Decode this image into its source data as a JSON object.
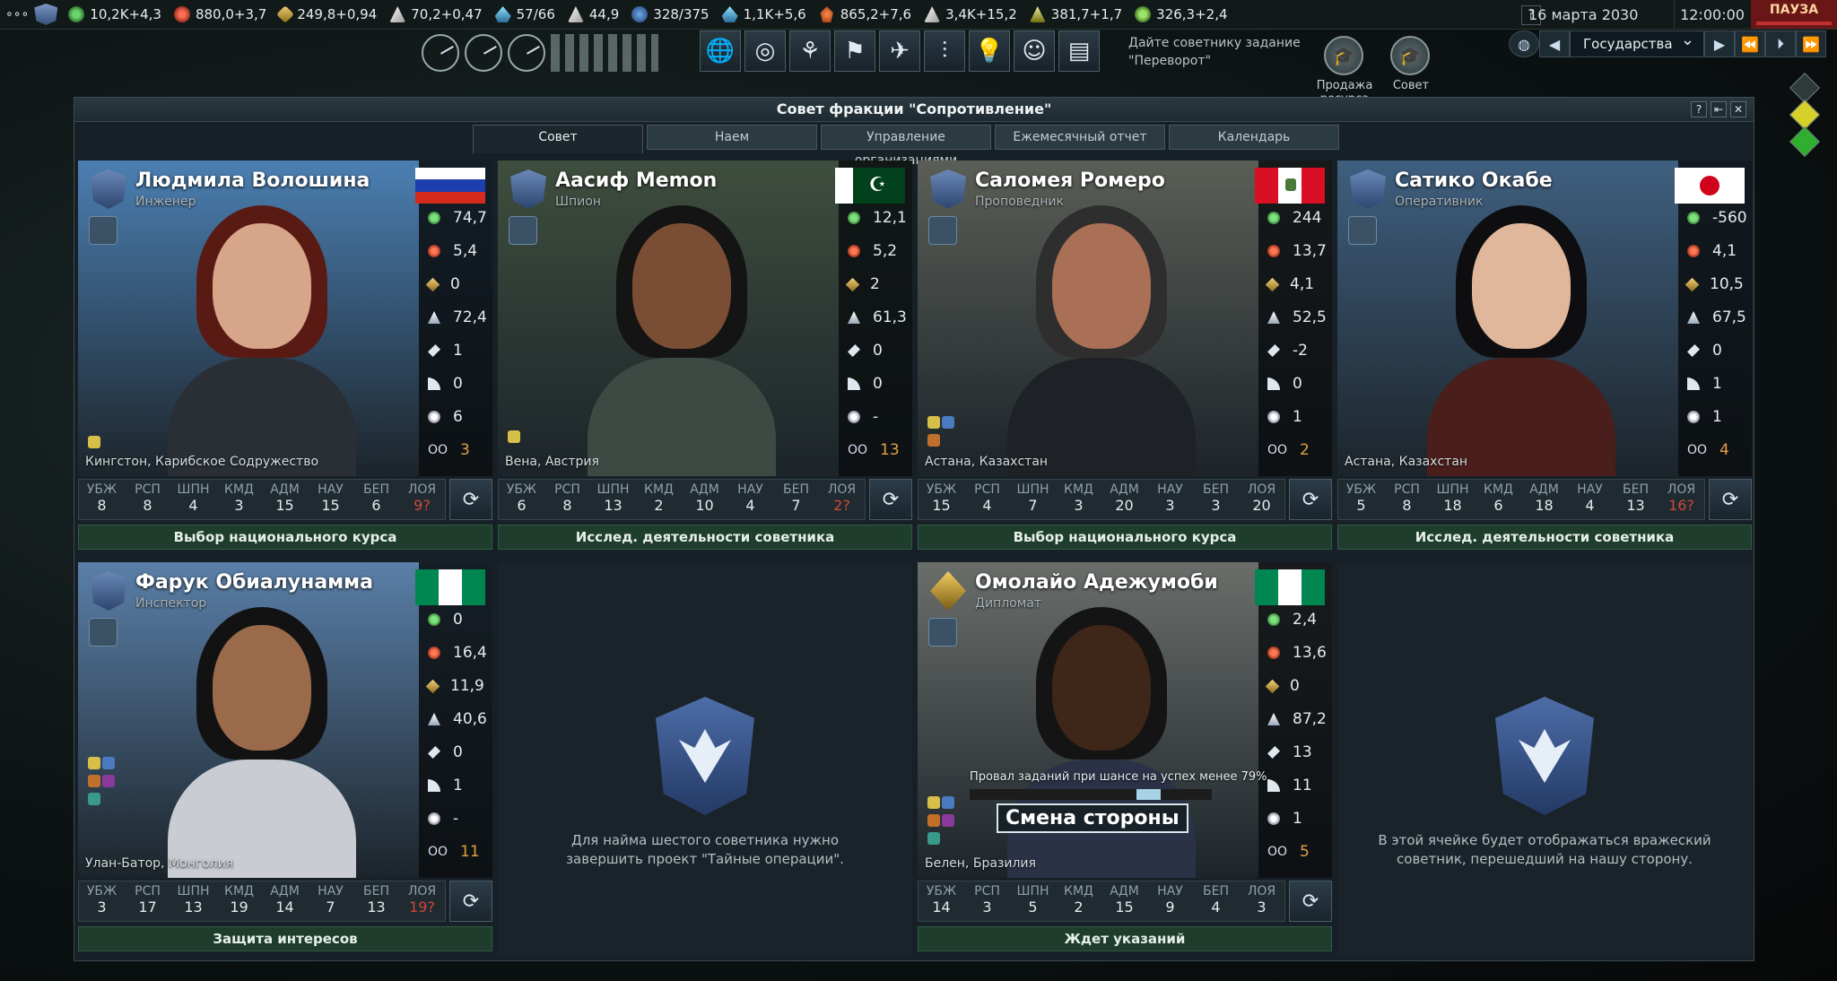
{
  "topbar": {
    "resources": [
      {
        "icon": "influence-icon",
        "color": "green",
        "value": "10,2K+4,3"
      },
      {
        "icon": "operations-icon",
        "color": "red",
        "value": "880,0+3,7"
      },
      {
        "icon": "boost-icon",
        "color": "gold",
        "value": "249,8+0,94"
      },
      {
        "icon": "mission-control-icon",
        "color": "white",
        "value": "70,2+0,47"
      },
      {
        "icon": "control-points-icon",
        "color": "cyan",
        "value": "57/66"
      },
      {
        "icon": "research-icon",
        "color": "white",
        "value": "44,9"
      },
      {
        "icon": "nations-icon",
        "color": "blue",
        "value": "328/375"
      },
      {
        "icon": "water-icon",
        "color": "cyan",
        "value": "1,1K+5,6"
      },
      {
        "icon": "volatiles-icon",
        "color": "orange",
        "value": "865,2+7,6"
      },
      {
        "icon": "metals-icon",
        "color": "white",
        "value": "3,4K+15,2"
      },
      {
        "icon": "noble-metals-icon",
        "color": "yellowg",
        "value": "381,7+1,7"
      },
      {
        "icon": "fissiles-icon",
        "color": "rad",
        "value": "326,3+2,4"
      }
    ],
    "date": "16 марта 2030",
    "time": "12:00:00",
    "pause": "ПАУЗА",
    "help": "?"
  },
  "toolbar": {
    "task_hint": "Дайте советнику задание \"Переворот\"",
    "sell_resource_label": "Продажа ресурса",
    "council_label": "Совет",
    "nation_select": "Государства"
  },
  "window": {
    "title": "Совет фракции \"Сопротивление\"",
    "tabs": [
      "Совет",
      "Наем",
      "Управление организациями",
      "Ежемесячный отчет",
      "Календарь"
    ],
    "active_tab": "Совет",
    "attr_names": [
      "УБЖ",
      "РСП",
      "ШПН",
      "КМД",
      "АДМ",
      "НАУ",
      "БЕП",
      "ЛОЯ"
    ]
  },
  "councilors": [
    {
      "name": "Людмила Волошина",
      "role": "Инженер",
      "flag": "russia",
      "location": "Кингстон, Карибское Содружество",
      "stats": [
        "74,7",
        "5,4",
        "0",
        "72,4",
        "1",
        "0",
        "6",
        "3"
      ],
      "attrs": [
        "8",
        "8",
        "4",
        "3",
        "15",
        "15",
        "6",
        "9?"
      ],
      "status": "Выбор национального курса",
      "palette": {
        "bg": "#4b7fb2",
        "hair": "#5a1a14",
        "skin": "#d6a58a",
        "body": "#2a2f36"
      }
    },
    {
      "name": "Аасиф Memon",
      "role": "Шпион",
      "flag": "pakistan",
      "location": "Вена, Австрия",
      "stats": [
        "12,1",
        "5,2",
        "2",
        "61,3",
        "0",
        "0",
        "-",
        "13"
      ],
      "attrs": [
        "6",
        "8",
        "13",
        "2",
        "10",
        "4",
        "7",
        "2?"
      ],
      "status": "Исслед. деятельности советника",
      "palette": {
        "bg": "#3e4e3e",
        "hair": "#141414",
        "skin": "#7a4e34",
        "body": "#3d4a44"
      }
    },
    {
      "name": "Саломея Ромеро",
      "role": "Проповедник",
      "flag": "peru",
      "location": "Астана, Казахстан",
      "stats": [
        "244",
        "13,7",
        "4,1",
        "52,5",
        "-2",
        "0",
        "1",
        "2"
      ],
      "attrs": [
        "15",
        "4",
        "7",
        "3",
        "20",
        "3",
        "3",
        "20"
      ],
      "status": "Выбор национального курса",
      "palette": {
        "bg": "#5a5e56",
        "hair": "#2e2e2e",
        "skin": "#a97055",
        "body": "#1e2226"
      }
    },
    {
      "name": "Сатико Окабе",
      "role": "Оперативник",
      "flag": "japan",
      "location": "Астана, Казахстан",
      "stats": [
        "-560",
        "4,1",
        "10,5",
        "67,5",
        "0",
        "1",
        "1",
        "4"
      ],
      "attrs": [
        "5",
        "8",
        "18",
        "6",
        "18",
        "4",
        "13",
        "16?"
      ],
      "status": "Исслед. деятельности советника",
      "palette": {
        "bg": "#3f5f7f",
        "hair": "#0e0e10",
        "skin": "#e0b79a",
        "body": "#4a1e1a"
      }
    },
    {
      "name": "Фарук Обиалунамма",
      "role": "Инспектор",
      "flag": "nigeria",
      "location": "Улан-Батор, Монголия",
      "stats": [
        "0",
        "16,4",
        "11,9",
        "40,6",
        "0",
        "1",
        "-",
        "11"
      ],
      "attrs": [
        "3",
        "17",
        "13",
        "19",
        "14",
        "7",
        "13",
        "19?"
      ],
      "status": "Защита интересов",
      "palette": {
        "bg": "#5a7fa8",
        "hair": "#121212",
        "skin": "#9a6a4a",
        "body": "#c9ccd2"
      }
    },
    {
      "name": "Омолайо Адежумоби",
      "role": "Дипломат",
      "flag": "nigeria",
      "location": "Белен, Бразилия",
      "stats": [
        "2,4",
        "13,6",
        "0",
        "87,2",
        "13",
        "11",
        "1",
        "5"
      ],
      "attrs": [
        "14",
        "3",
        "5",
        "2",
        "15",
        "9",
        "4",
        "3"
      ],
      "status": "Ждет указаний",
      "mission_note": "Провал заданий при шансе на успех менее 79%",
      "mission_progress": 0.79,
      "mission_name": "Смена стороны",
      "palette": {
        "bg": "#6a6e6a",
        "hair": "#141414",
        "skin": "#3e2618",
        "body": "#2b3146"
      }
    }
  ],
  "empty_slots": [
    "Для найма шестого советника нужно завершить проект \"Тайные операции\".",
    "В этой ячейке будет отображаться вражеский советник, перешедший на нашу сторону."
  ]
}
